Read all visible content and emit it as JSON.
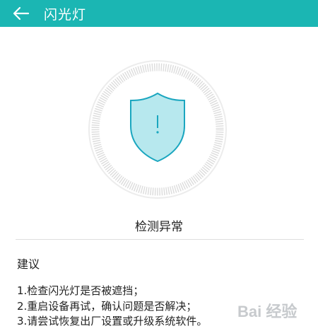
{
  "header": {
    "title": "闪光灯",
    "background_color": "#1bb6b3"
  },
  "status": {
    "text": "检测异常",
    "icon": "shield-warning-icon",
    "shield_fill": "#b7e8ee",
    "shield_stroke": "#1aa6bf"
  },
  "suggestions": {
    "title": "建议",
    "items": [
      "1.检查闪光灯是否被遮挡；",
      "2.重启设备再试，确认问题是否解决；",
      "3.请尝试恢复出厂设置或升级系统软件。"
    ]
  },
  "watermark": {
    "text": "Bai 经验"
  }
}
